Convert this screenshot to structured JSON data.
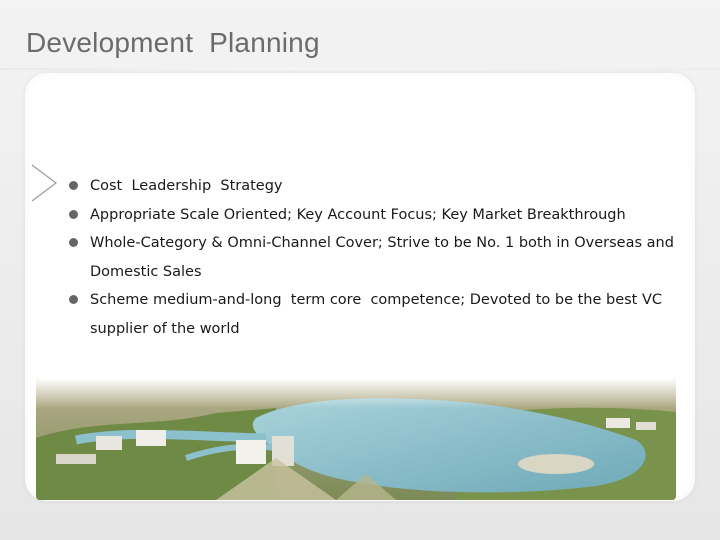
{
  "slide": {
    "title": "Development  Planning"
  },
  "bullets": [
    {
      "text": "Cost  Leadership  Strategy"
    },
    {
      "text": "Appropriate Scale Oriented; Key Account Focus; Key Market Breakthrough"
    },
    {
      "text": "Whole-Category & Omni-Channel Cover; Strive to be No. 1 both in Overseas and Domestic Sales"
    },
    {
      "text": "Scheme medium-and-long  term core  competence; Devoted to be the best VC supplier of the world"
    }
  ],
  "colors": {
    "title": "#6b6b6b",
    "bullet": "#666666",
    "text": "#1a1a1a",
    "water": "#8fc3cf"
  },
  "icons": {
    "section_marker": "chevron-right-icon"
  }
}
